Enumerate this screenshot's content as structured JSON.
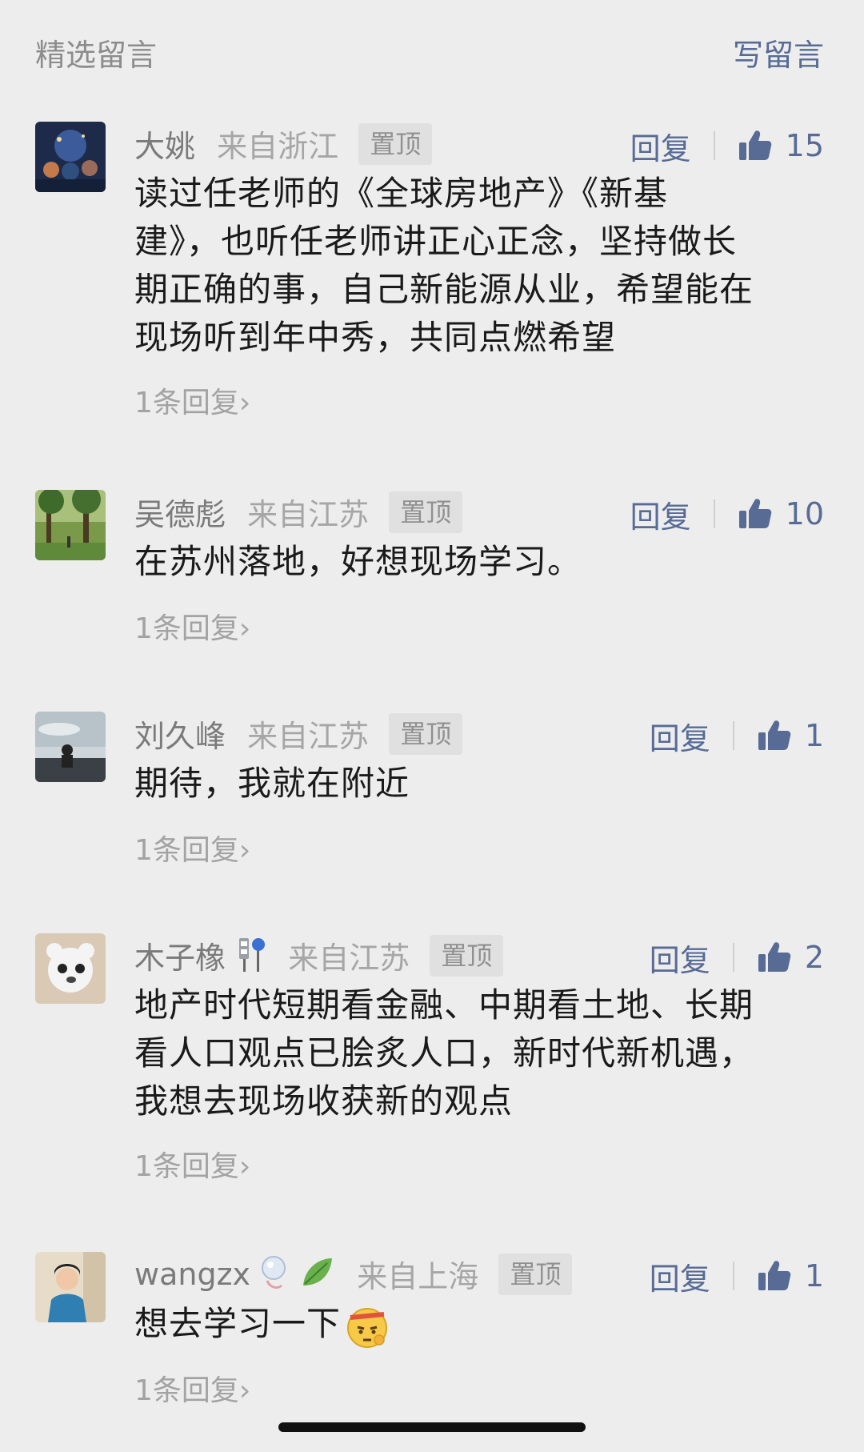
{
  "header": {
    "title": "精选留言",
    "write_label": "写留言"
  },
  "comments": [
    {
      "nickname": "大姚",
      "location": "来自浙江",
      "pin": "置顶",
      "reply_label": "回复",
      "likes": "15",
      "lines": [
        "读过任老师的《全球房地产》《新基",
        "建》，也听任老师讲正心正念，坚持做长",
        "期正确的事，自己新能源从业，希望能在",
        "现场听到年中秀，共同点燃希望"
      ],
      "sub_replies": "1条回复"
    },
    {
      "nickname": "吴德彪",
      "location": "来自江苏",
      "pin": "置顶",
      "reply_label": "回复",
      "likes": "10",
      "lines": [
        "在苏州落地，好想现场学习。"
      ],
      "sub_replies": "1条回复"
    },
    {
      "nickname": "刘久峰",
      "location": "来自江苏",
      "pin": "置顶",
      "reply_label": "回复",
      "likes": "1",
      "lines": [
        "期待，我就在附近"
      ],
      "sub_replies": "1条回复"
    },
    {
      "nickname": "木子橡",
      "location": "来自江苏",
      "pin": "置顶",
      "reply_label": "回复",
      "likes": "2",
      "lines": [
        "地产时代短期看金融、中期看土地、长期",
        "看人口观点已脍炙人口，新时代新机遇，",
        "我想去现场收获新的观点"
      ],
      "sub_replies": "1条回复"
    },
    {
      "nickname": "wangzx",
      "location": "来自上海",
      "pin": "置顶",
      "reply_label": "回复",
      "likes": "1",
      "lines": [
        "想去学习一下"
      ],
      "sub_replies": "1条回复"
    }
  ],
  "colors": {
    "link": "#576b95",
    "background": "#ededed"
  },
  "icons": {
    "like": "thumbs-up-icon",
    "chevron": "chevron-right-icon"
  }
}
